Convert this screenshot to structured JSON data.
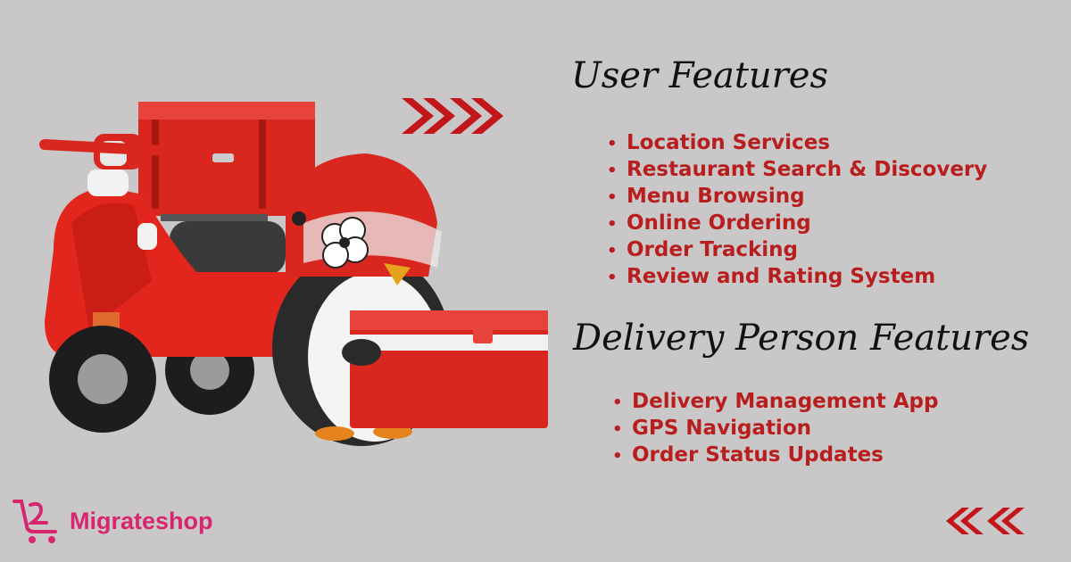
{
  "colors": {
    "background": "#c9c7c7",
    "accent_red": "#b81e1e",
    "brand_pink": "#d7266f",
    "heading": "#111111"
  },
  "user_features": {
    "heading": "User Features",
    "items": [
      "Location Services",
      "Restaurant Search & Discovery",
      "Menu Browsing",
      "Online Ordering",
      "Order Tracking",
      "Review and Rating System"
    ]
  },
  "delivery_features": {
    "heading": "Delivery Person Features",
    "items": [
      "Delivery Management App",
      "GPS Navigation",
      "Order Status Updates"
    ]
  },
  "brand": {
    "name": "Migrateshop",
    "icon": "shopping-cart-logo-icon"
  },
  "decor": {
    "top_arrows_icon": "double-chevron-right-icon",
    "bottom_arrows_icon": "double-chevron-left-icon",
    "illustration": "penguin-delivery-scooter-illustration"
  }
}
